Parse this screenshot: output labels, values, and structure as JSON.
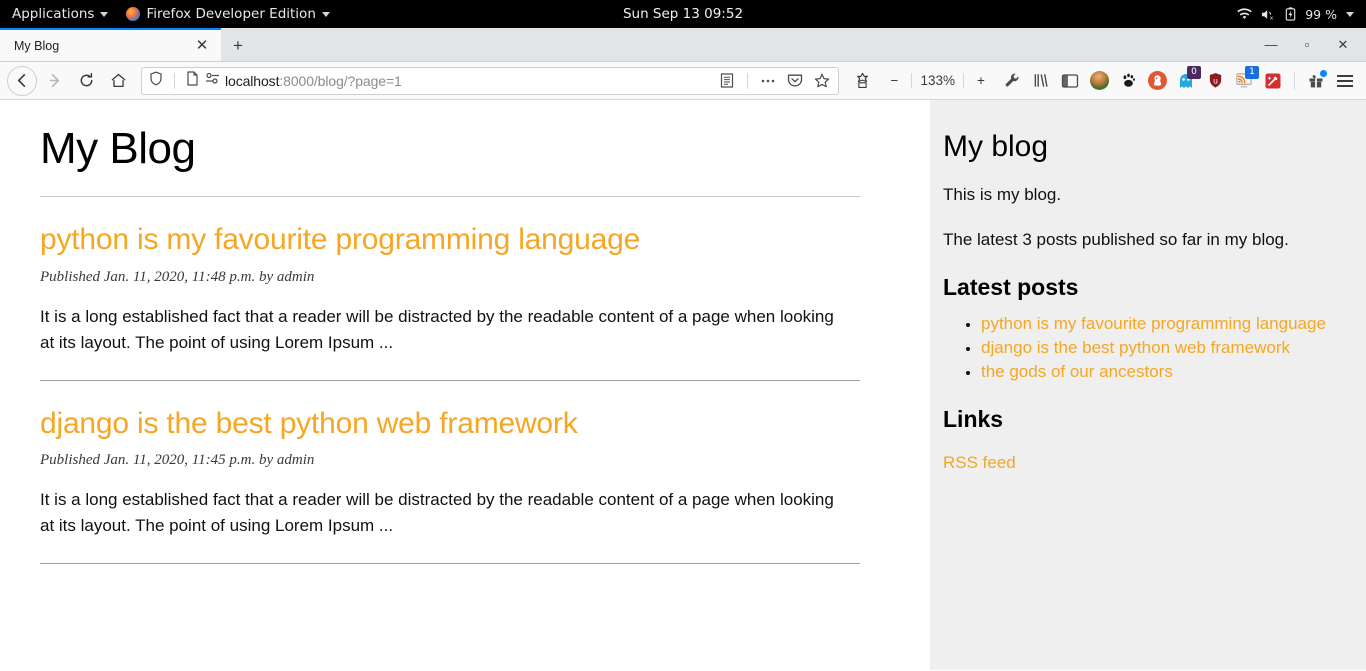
{
  "system_bar": {
    "applications_label": "Applications",
    "firefox_label": "Firefox Developer Edition",
    "clock": "Sun Sep 13  09:52",
    "battery": "99 %",
    "icons": [
      "wifi-icon",
      "volume-muted-icon",
      "battery-icon"
    ]
  },
  "browser": {
    "tab": {
      "title": "My Blog",
      "close_label": "✕"
    },
    "new_tab_label": "+",
    "window_controls": {
      "minimize": "—",
      "maximize": "▫",
      "close": "✕"
    },
    "url": {
      "host": "localhost",
      "rest": ":8000/blog/?page=1"
    },
    "zoom_level": "133%",
    "zoom_out_label": "−",
    "zoom_in_label": "+",
    "extensions": [
      {
        "name": "ghostery-icon",
        "badge": "0"
      },
      {
        "name": "ublock-origin-icon",
        "badge": ""
      },
      {
        "name": "rss-reader-icon",
        "badge": "1"
      },
      {
        "name": "wand-icon",
        "badge": ""
      }
    ]
  },
  "blog": {
    "site_title": "My Blog",
    "posts": [
      {
        "title": "python is my favourite programming language",
        "meta": "Published Jan. 11, 2020, 11:48 p.m. by admin",
        "excerpt": "It is a long established fact that a reader will be distracted by the readable content of a page when looking at its layout. The point of using Lorem Ipsum ..."
      },
      {
        "title": "django is the best python web framework",
        "meta": "Published Jan. 11, 2020, 11:45 p.m. by admin",
        "excerpt": "It is a long established fact that a reader will be distracted by the readable content of a page when looking at its layout. The point of using Lorem Ipsum ..."
      }
    ]
  },
  "sidebar": {
    "title": "My blog",
    "description": "This is my blog.",
    "summary": "The latest 3 posts published so far in my blog.",
    "latest_heading": "Latest posts",
    "latest_posts": [
      "python is my favourite programming language",
      "django is the best python web framework",
      "the gods of our ancestors"
    ],
    "links_heading": "Links",
    "rss_label": "RSS feed"
  },
  "colors": {
    "accent": "#f5a623",
    "sidebar_bg": "#efefef",
    "tab_accent": "#0a84ff"
  }
}
